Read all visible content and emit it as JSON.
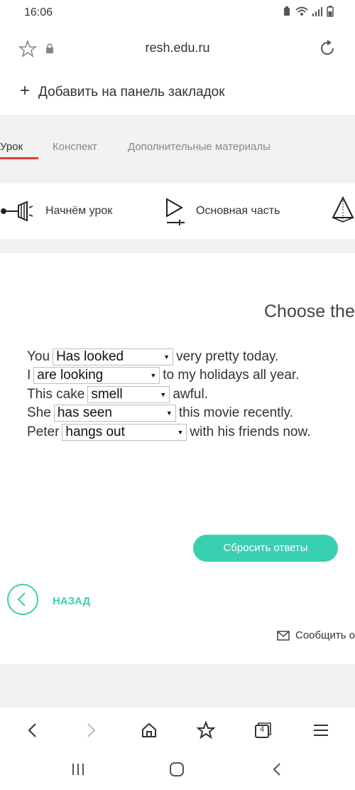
{
  "status": {
    "time": "16:06"
  },
  "browser": {
    "url": "resh.edu.ru",
    "bookmark_label": "Добавить на панель закладок",
    "tab_count": "4"
  },
  "tabs": [
    {
      "label": "Урок",
      "active": true
    },
    {
      "label": "Конспект"
    },
    {
      "label": "Дополнительные материалы"
    }
  ],
  "parts": [
    {
      "label": "Начнём урок",
      "icon": "megaphone-icon"
    },
    {
      "label": "Основная часть",
      "icon": "play-icon"
    }
  ],
  "task": {
    "title": "Choose the",
    "lines": [
      {
        "before": "You",
        "selected": "Has looked",
        "after": "very pretty today."
      },
      {
        "before": "I",
        "selected": "are looking",
        "after": "to my holidays all year."
      },
      {
        "before": "This cake",
        "selected": "smell",
        "after": "awful."
      },
      {
        "before": "She",
        "selected": "has seen",
        "after": "this movie recently."
      },
      {
        "before": "Peter",
        "selected": "hangs out",
        "after": "with his friends now."
      }
    ],
    "reset_label": "Сбросить ответы",
    "back_label": "НАЗАД",
    "report_label": "Сообщить о"
  },
  "colors": {
    "accent": "#39d0b2",
    "tab_underline": "#e63b3b"
  }
}
